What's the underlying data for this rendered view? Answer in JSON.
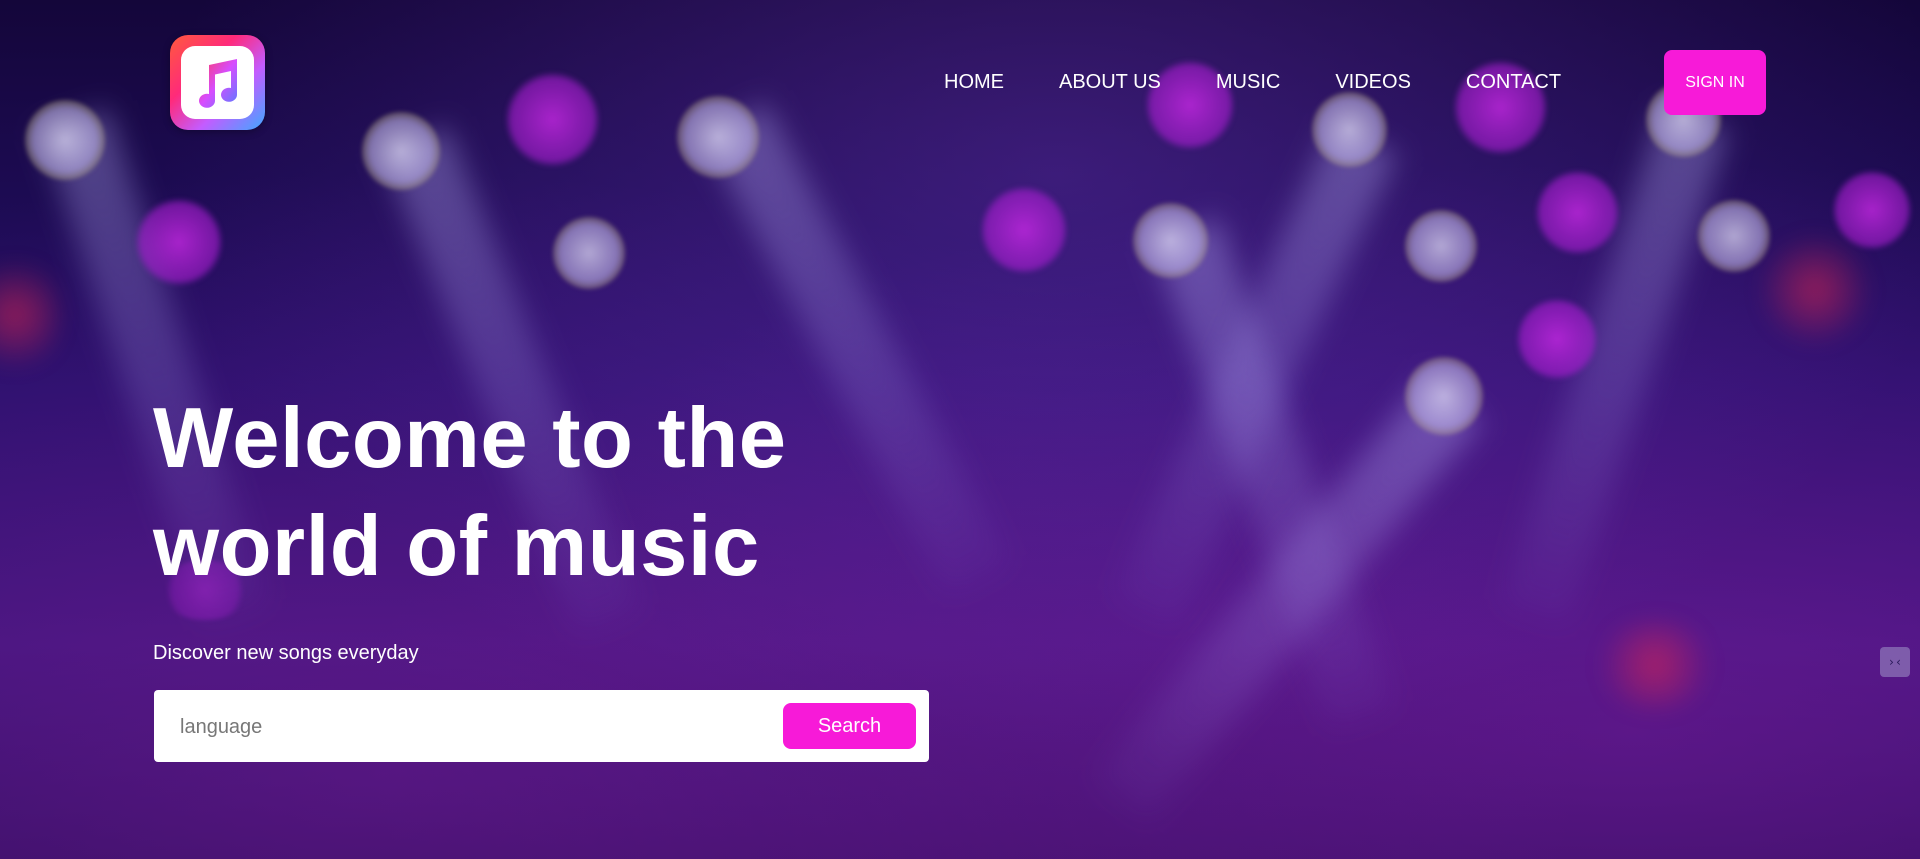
{
  "brand": {
    "logo_icon": "music-note-icon"
  },
  "nav": {
    "items": [
      {
        "label": "HOME"
      },
      {
        "label": "ABOUT US"
      },
      {
        "label": "MUSIC"
      },
      {
        "label": "VIDEOS"
      },
      {
        "label": "CONTACT"
      }
    ]
  },
  "header": {
    "signin_label": "SIGN IN"
  },
  "hero": {
    "title_line1": "Welcome to the",
    "title_line2": "world of music",
    "subtitle": "Discover new songs everyday"
  },
  "search": {
    "placeholder": "language",
    "value": "",
    "button_label": "Search"
  },
  "side_widget": {
    "icon": "collapse-arrows-icon",
    "glyph": "›‹"
  },
  "colors": {
    "accent": "#f71ad8",
    "background": "#1a0a4a",
    "text": "#ffffff"
  }
}
